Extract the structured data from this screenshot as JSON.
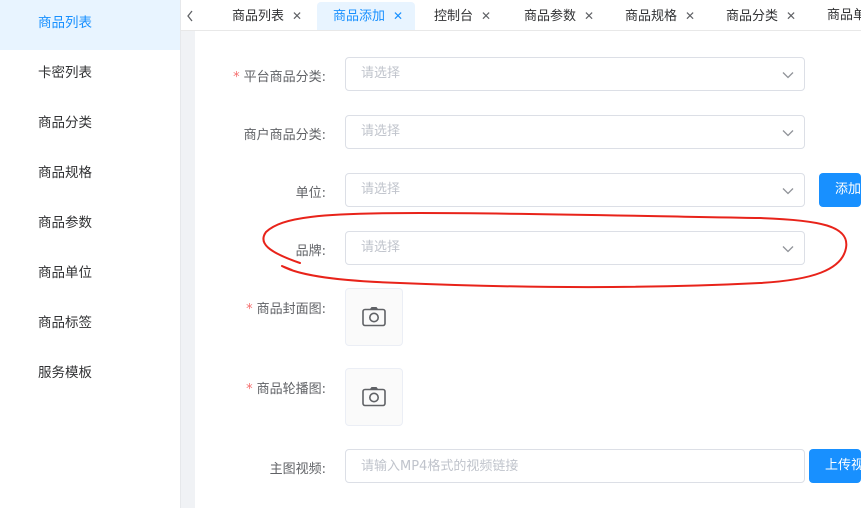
{
  "sidebar": {
    "items": [
      {
        "label": "商品列表",
        "active": true
      },
      {
        "label": "卡密列表"
      },
      {
        "label": "商品分类"
      },
      {
        "label": "商品规格"
      },
      {
        "label": "商品参数"
      },
      {
        "label": "商品单位"
      },
      {
        "label": "商品标签"
      },
      {
        "label": "服务模板"
      }
    ]
  },
  "tabs": {
    "items": [
      {
        "label": "商品列表"
      },
      {
        "label": "商品添加",
        "active": true
      },
      {
        "label": "控制台"
      },
      {
        "label": "商品参数"
      },
      {
        "label": "商品规格"
      },
      {
        "label": "商品分类"
      },
      {
        "label": "商品单"
      }
    ]
  },
  "form": {
    "platform_category": {
      "label": "平台商品分类:",
      "placeholder": "请选择",
      "required": true
    },
    "merchant_category": {
      "label": "商户商品分类:",
      "placeholder": "请选择"
    },
    "unit": {
      "label": "单位:",
      "placeholder": "请选择",
      "add_button": "添加单"
    },
    "brand": {
      "label": "品牌:",
      "placeholder": "请选择"
    },
    "cover_image": {
      "label": "商品封面图:",
      "required": true
    },
    "carousel_image": {
      "label": "商品轮播图:",
      "required": true
    },
    "main_video": {
      "label": "主图视频:",
      "placeholder": "请输入MP4格式的视频链接",
      "upload_button": "上传视"
    }
  },
  "colors": {
    "primary": "#1890ff",
    "required": "#f56c6c",
    "annotation": "#e8231a"
  },
  "icons": {
    "chevron": "chevron-down-icon",
    "camera": "camera-icon",
    "tab_back": "chevron-left-icon",
    "tab_close": "close-icon"
  }
}
